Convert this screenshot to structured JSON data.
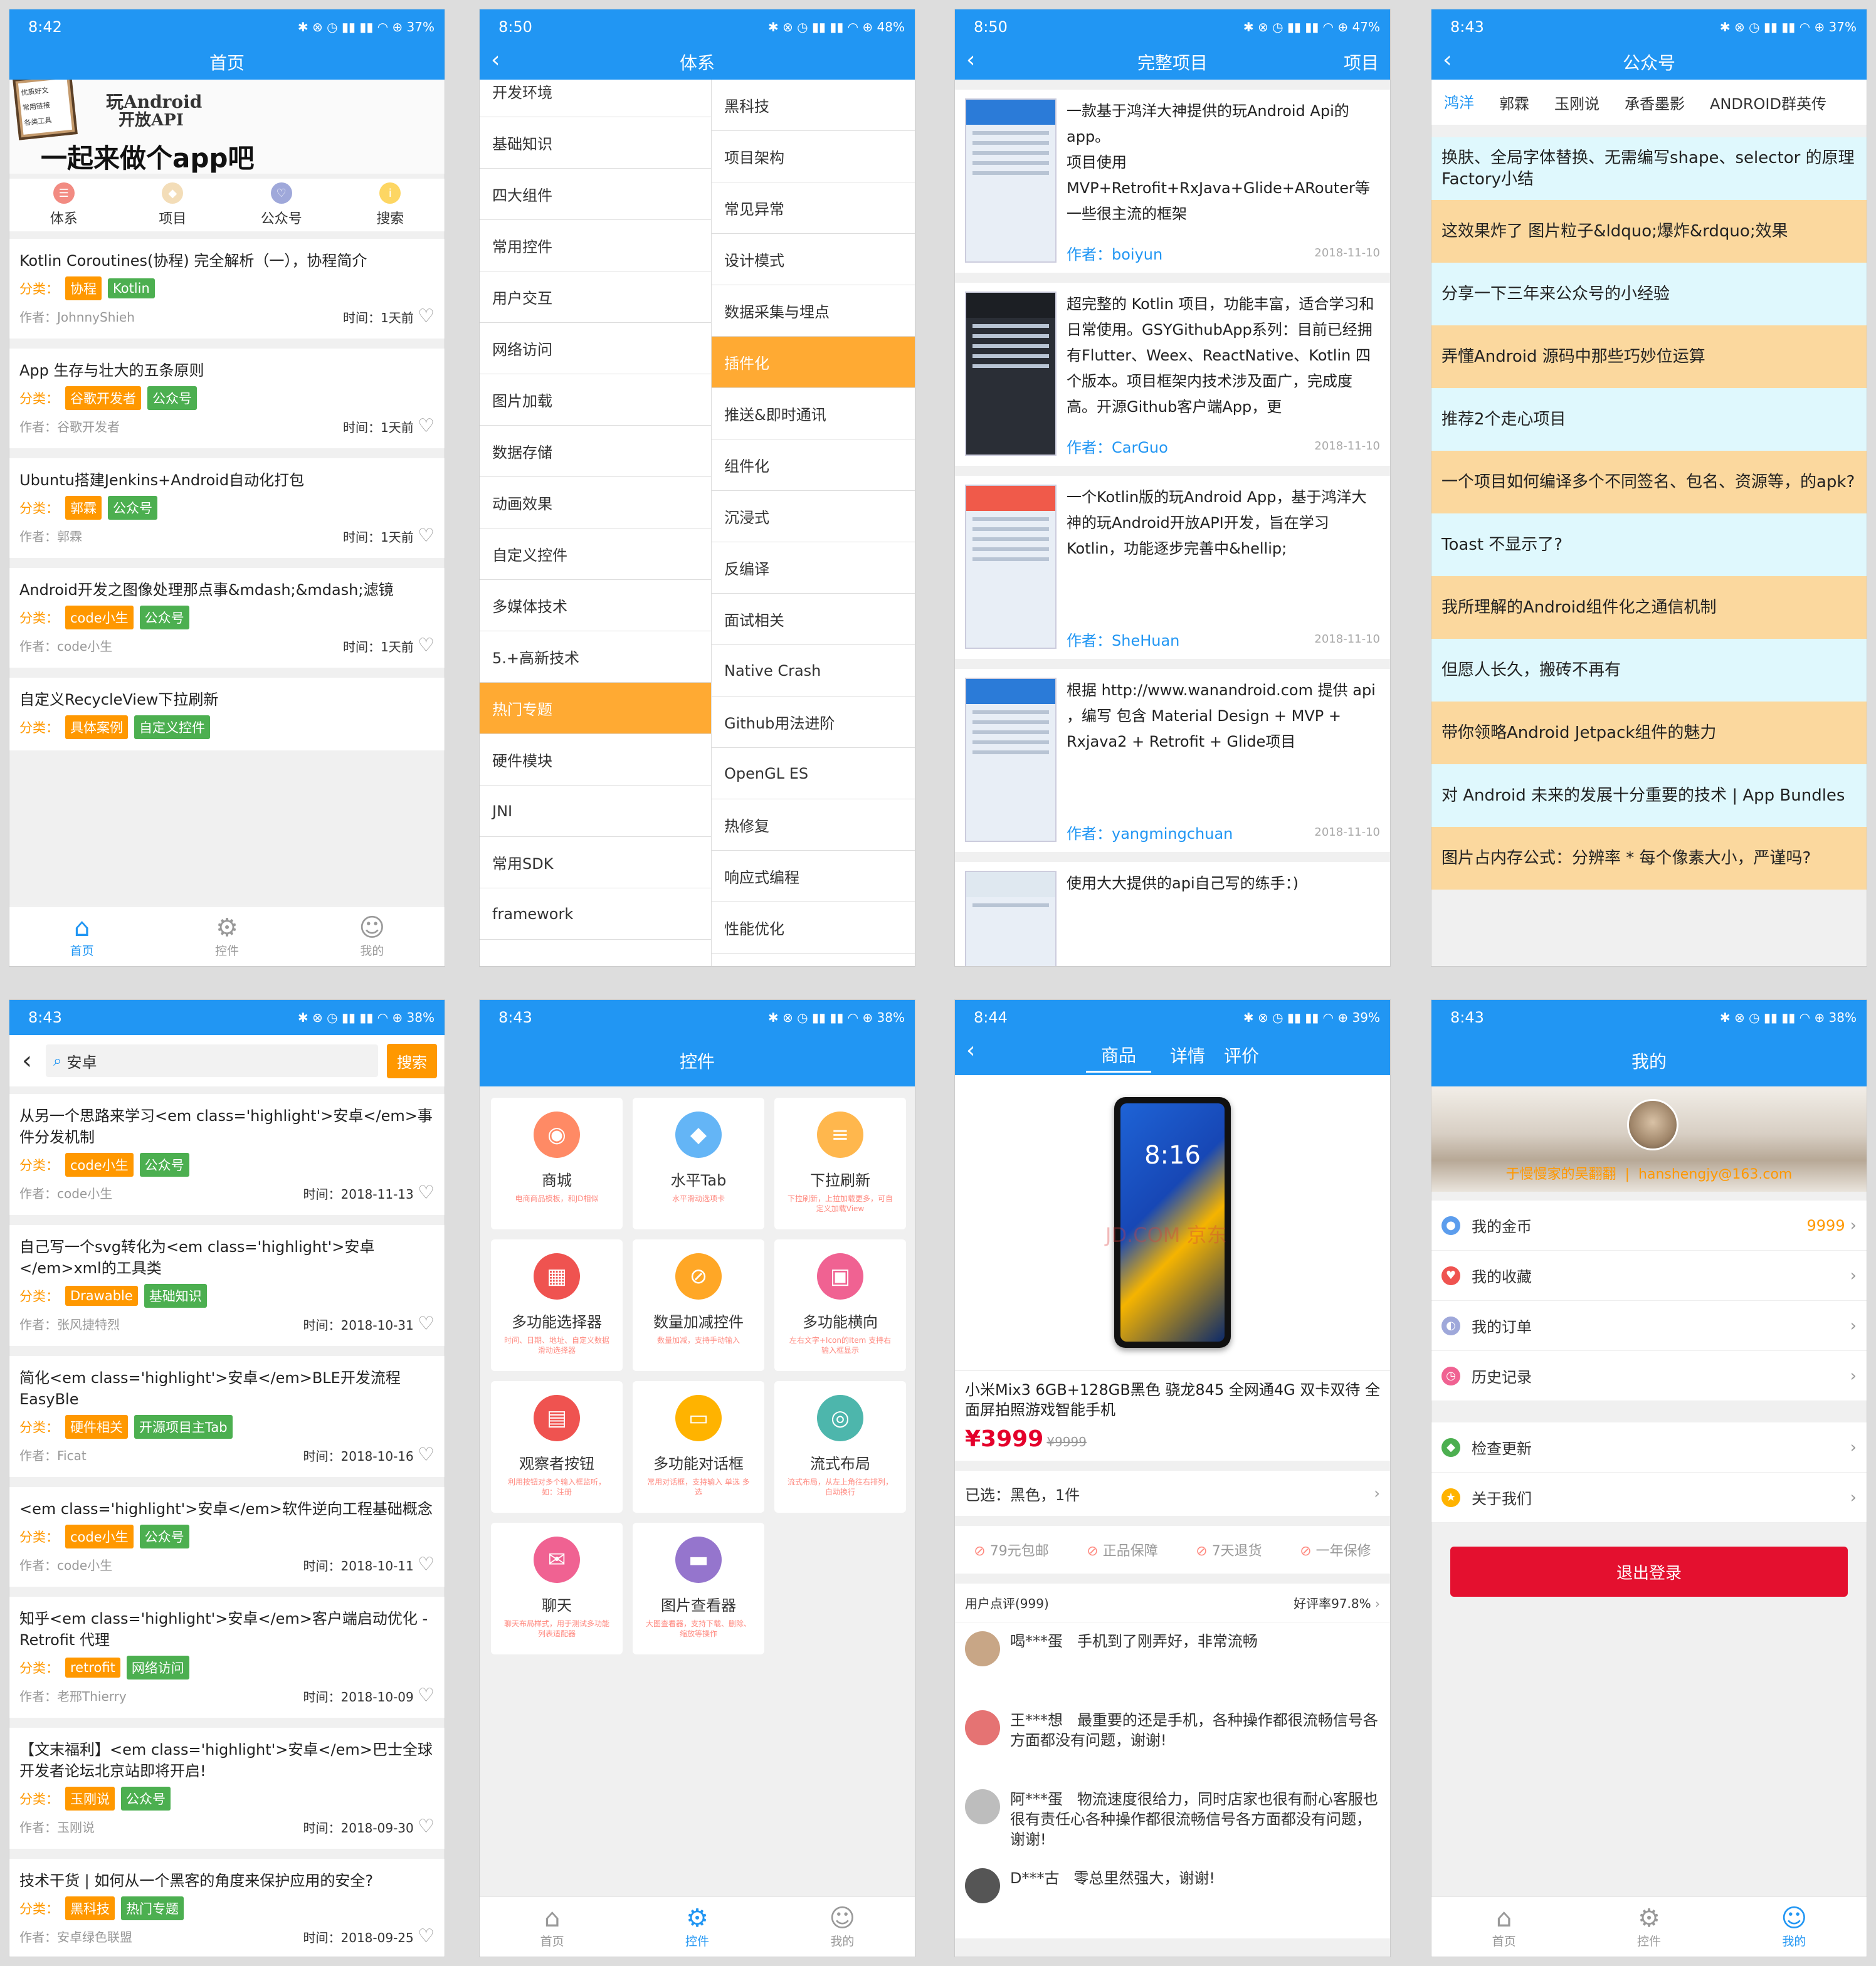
{
  "p1": {
    "time": "8:42",
    "battery": "37%",
    "title": "首页",
    "banner": {
      "checks": [
        "优质好文",
        "常用链接",
        "各类工具"
      ],
      "line1": "玩Android",
      "line2": "开放API",
      "slogan": "一起来做个app吧"
    },
    "cats": [
      {
        "label": "体系",
        "color": "#f28b82",
        "icon": "☰"
      },
      {
        "label": "项目",
        "color": "#f3ddb8",
        "icon": "◆"
      },
      {
        "label": "公众号",
        "color": "#9fa8da",
        "icon": "♡"
      },
      {
        "label": "搜索",
        "color": "#fdd663",
        "icon": "i"
      }
    ],
    "articles": [
      {
        "title": "Kotlin Coroutines(协程) 完全解析（一），协程简介",
        "tags": [
          "协程",
          "Kotlin"
        ],
        "tag_colors": [
          "#ff9800",
          "#4caf50"
        ],
        "author": "作者：JohnnyShieh",
        "time": "时间：1天前"
      },
      {
        "title": "App 生存与壮大的五条原则",
        "tags": [
          "谷歌开发者",
          "公众号"
        ],
        "tag_colors": [
          "#ff9800",
          "#4caf50"
        ],
        "author": "作者：谷歌开发者",
        "time": "时间：1天前"
      },
      {
        "title": "Ubuntu搭建Jenkins+Android自动化打包",
        "tags": [
          "郭霖",
          "公众号"
        ],
        "tag_colors": [
          "#ff9800",
          "#4caf50"
        ],
        "author": "作者：郭霖",
        "time": "时间：1天前"
      },
      {
        "title": "Android开发之图像处理那点事&mdash;&mdash;滤镜",
        "tags": [
          "code小生",
          "公众号"
        ],
        "tag_colors": [
          "#ff9800",
          "#4caf50"
        ],
        "author": "作者：code小生",
        "time": "时间：1天前"
      },
      {
        "title": "自定义RecycleView下拉刷新",
        "tags": [
          "具体案例",
          "自定义控件"
        ],
        "tag_colors": [
          "#ff9800",
          "#4caf50"
        ],
        "author": "",
        "time": ""
      }
    ],
    "cat_label": "分类：",
    "nav": [
      {
        "label": "首页",
        "icon": "⌂"
      },
      {
        "label": "控件",
        "icon": "⚙"
      },
      {
        "label": "我的",
        "icon": "☺"
      }
    ]
  },
  "p2": {
    "time": "8:50",
    "battery": "48%",
    "title": "体系",
    "left": [
      "开发环境",
      "基础知识",
      "四大组件",
      "常用控件",
      "用户交互",
      "网络访问",
      "图片加载",
      "数据存储",
      "动画效果",
      "自定义控件",
      "多媒体技术",
      "5.+高新技术",
      "热门专题",
      "硬件模块",
      "JNI",
      "常用SDK",
      "framework"
    ],
    "right": [
      "黑科技",
      "项目架构",
      "常见异常",
      "设计模式",
      "数据采集与埋点",
      "插件化",
      "推送&即时通讯",
      "组件化",
      "沉浸式",
      "反编译",
      "面试相关",
      "Native Crash",
      "Github用法进阶",
      "OpenGL ES",
      "热修复",
      "响应式编程",
      "性能优化"
    ]
  },
  "p3": {
    "time": "8:50",
    "battery": "47%",
    "title": "完整项目",
    "right": "项目",
    "projects": [
      {
        "desc": "一款基于鸿洋大神提供的玩Android Api的app。\n项目使用MVP+Retrofit+RxJava+Glide+ARouter等一些很主流的框架",
        "author": "作者：boiyun",
        "date": "2018-11-10"
      },
      {
        "desc": "超完整的 Kotlin 项目，功能丰富，适合学习和日常使用。GSYGithubApp系列：目前已经拥有Flutter、Weex、ReactNative、Kotlin 四个版本。项目框架内技术涉及面广，完成度高。开源Github客户端App，更",
        "author": "作者：CarGuo",
        "date": "2018-11-10"
      },
      {
        "desc": "一个Kotlin版的玩Android App，基于鸿洋大神的玩Android开放API开发，旨在学习Kotlin，功能逐步完善中&hellip;",
        "author": "作者：SheHuan",
        "date": "2018-11-10"
      },
      {
        "desc": "根据 http://www.wanandroid.com 提供 api ，编写 包含 Material Design + MVP + Rxjava2 + Retrofit + Glide项目",
        "author": "作者：yangmingchuan",
        "date": "2018-11-10"
      },
      {
        "desc": "使用大大提供的api自己写的练手：)",
        "author": "",
        "date": ""
      }
    ]
  },
  "p4": {
    "time": "8:43",
    "battery": "37%",
    "title": "公众号",
    "tabs": [
      "鸿洋",
      "郭霖",
      "玉刚说",
      "承香墨影",
      "ANDROID群英传"
    ],
    "items": [
      "换肤、全局字体替换、无需编写shape、selector 的原理Factory小结",
      "这效果炸了 图片粒子&ldquo;爆炸&rdquo;效果",
      "分享一下三年来公众号的小经验",
      "弄懂Android 源码中那些巧妙位运算",
      "推荐2个走心项目",
      "一个项目如何编译多个不同签名、包名、资源等，的apk?",
      "Toast 不显示了?",
      "我所理解的Android组件化之通信机制",
      "但愿人长久，搬砖不再有",
      "带你领略Android Jetpack组件的魅力",
      "对 Android 未来的发展十分重要的技术 | App Bundles",
      "图片占内存公式：分辨率 * 每个像素大小，严谨吗?"
    ]
  },
  "p5": {
    "time": "8:43",
    "battery": "38%",
    "query": "安卓",
    "search": "搜索",
    "results": [
      {
        "title": "从另一个思路来学习<em class='highlight'>安卓</em>事件分发机制",
        "tags": [
          "code小生",
          "公众号"
        ],
        "author": "作者：code小生",
        "time": "时间：2018-11-13"
      },
      {
        "title": "自己写一个svg转化为<em class='highlight'>安卓</em>xml的工具类",
        "tags": [
          "Drawable",
          "基础知识"
        ],
        "author": "作者：张风捷特烈",
        "time": "时间：2018-10-31"
      },
      {
        "title": "简化<em class='highlight'>安卓</em>BLE开发流程 EasyBle",
        "tags": [
          "硬件相关",
          "开源项目主Tab"
        ],
        "author": "作者：Ficat",
        "time": "时间：2018-10-16"
      },
      {
        "title": "<em class='highlight'>安卓</em>软件逆向工程基础概念",
        "tags": [
          "code小生",
          "公众号"
        ],
        "author": "作者：code小生",
        "time": "时间：2018-10-11"
      },
      {
        "title": "知乎<em class='highlight'>安卓</em>客户端启动优化 - Retrofit 代理",
        "tags": [
          "retrofit",
          "网络访问"
        ],
        "author": "作者：老邢Thierry",
        "time": "时间：2018-10-09"
      },
      {
        "title": "【文末福利】<em class='highlight'>安卓</em>巴士全球开发者论坛北京站即将开启!",
        "tags": [
          "玉刚说",
          "公众号"
        ],
        "author": "作者：玉刚说",
        "time": "时间：2018-09-30"
      },
      {
        "title": "技术干货 | 如何从一个黑客的角度来保护应用的安全?",
        "tags": [
          "黑科技",
          "热门专题"
        ],
        "author": "作者：安卓绿色联盟",
        "time": "时间：2018-09-25"
      }
    ]
  },
  "p6": {
    "time": "8:43",
    "battery": "38%",
    "title": "控件",
    "widgets": [
      {
        "name": "商城",
        "sub": "电商商品模板，和JD相似",
        "color": "#ff8a65",
        "icon": "◉"
      },
      {
        "name": "水平Tab",
        "sub": "水平滑动选项卡",
        "color": "#64b5f6",
        "icon": "◆"
      },
      {
        "name": "下拉刷新",
        "sub": "下拉刷新，上拉加载更多，可自定义加载View",
        "color": "#ffb74d",
        "icon": "≡"
      },
      {
        "name": "多功能选择器",
        "sub": "时间、日期、地址、自定义数据滑动选择器",
        "color": "#ef5350",
        "icon": "▦"
      },
      {
        "name": "数量加减控件",
        "sub": "数量加减，支持手动输入",
        "color": "#ffa726",
        "icon": "⊘"
      },
      {
        "name": "多功能横向",
        "sub": "左右文字+Icon的Item 支持右输入框显示",
        "color": "#f06292",
        "icon": "▣"
      },
      {
        "name": "观察者按钮",
        "sub": "利用按钮对多个输入框监听，如：注册",
        "color": "#ef5350",
        "icon": "▤"
      },
      {
        "name": "多功能对话框",
        "sub": "常用对话框，支持输入 单选 多选",
        "color": "#ffb300",
        "icon": "▭"
      },
      {
        "name": "流式布局",
        "sub": "流式布局，从左上角往右排列，自动换行",
        "color": "#4db6ac",
        "icon": "◎"
      },
      {
        "name": "聊天",
        "sub": "聊天布局样式，用于测试多功能列表适配器",
        "color": "#f06292",
        "icon": "✉"
      },
      {
        "name": "图片查看器",
        "sub": "大图查看器，支持下载、删除、缩放等操作",
        "color": "#9575cd",
        "icon": "▬"
      }
    ],
    "nav": [
      {
        "label": "首页",
        "icon": "⌂"
      },
      {
        "label": "控件",
        "icon": "⚙"
      },
      {
        "label": "我的",
        "icon": "☺"
      }
    ]
  },
  "p7": {
    "time": "8:44",
    "battery": "39%",
    "tabs": [
      "商品",
      "详情",
      "评价"
    ],
    "phone_time": "8:16",
    "watermark": "JD.COM 京东",
    "product": "小米Mix3 6GB+128GB黑色 骁龙845 全网通4G 双卡双待 全面屏拍照游戏智能手机",
    "price": "¥3999",
    "old_price": "¥9999",
    "selected": "已选：黑色，1件",
    "guarantees": [
      "79元包邮",
      "正品保障",
      "7天退货",
      "一年保修"
    ],
    "review_title": "用户点评(999)",
    "rate": "好评率97.8%",
    "reviews": [
      {
        "user": "喝***蛋",
        "text": "手机到了刚弄好，非常流畅"
      },
      {
        "user": "王***想",
        "text": "最重要的还是手机，各种操作都很流畅信号各方面都没有问题，谢谢!"
      },
      {
        "user": "阿***蛋",
        "text": "物流速度很给力，同时店家也很有耐心客服也很有责任心各种操作都很流畅信号各方面都没有问题，谢谢!"
      },
      {
        "user": "D***古",
        "text": "零总里然强大，谢谢!"
      }
    ]
  },
  "p8": {
    "time": "8:43",
    "battery": "38%",
    "title": "我的",
    "user": "于慢慢家的吴翻翻",
    "email": "hanshengjy@163.com",
    "rows1": [
      {
        "label": "我的金币",
        "value": "9999",
        "color": "#5c9ded"
      },
      {
        "label": "我的收藏",
        "value": "",
        "color": "#ef5350"
      },
      {
        "label": "我的订单",
        "value": "",
        "color": "#9fa8da"
      },
      {
        "label": "历史记录",
        "value": "",
        "color": "#f06292"
      }
    ],
    "rows2": [
      {
        "label": "检查更新",
        "value": "",
        "color": "#4caf50"
      },
      {
        "label": "关于我们",
        "value": "",
        "color": "#ffb300"
      }
    ],
    "logout": "退出登录",
    "nav": [
      {
        "label": "首页",
        "icon": "⌂"
      },
      {
        "label": "控件",
        "icon": "⚙"
      },
      {
        "label": "我的",
        "icon": "☺"
      }
    ]
  },
  "status_icons": "✱ ⊗ ◷ ▮▮ ▮▮ ◠ ⊕"
}
